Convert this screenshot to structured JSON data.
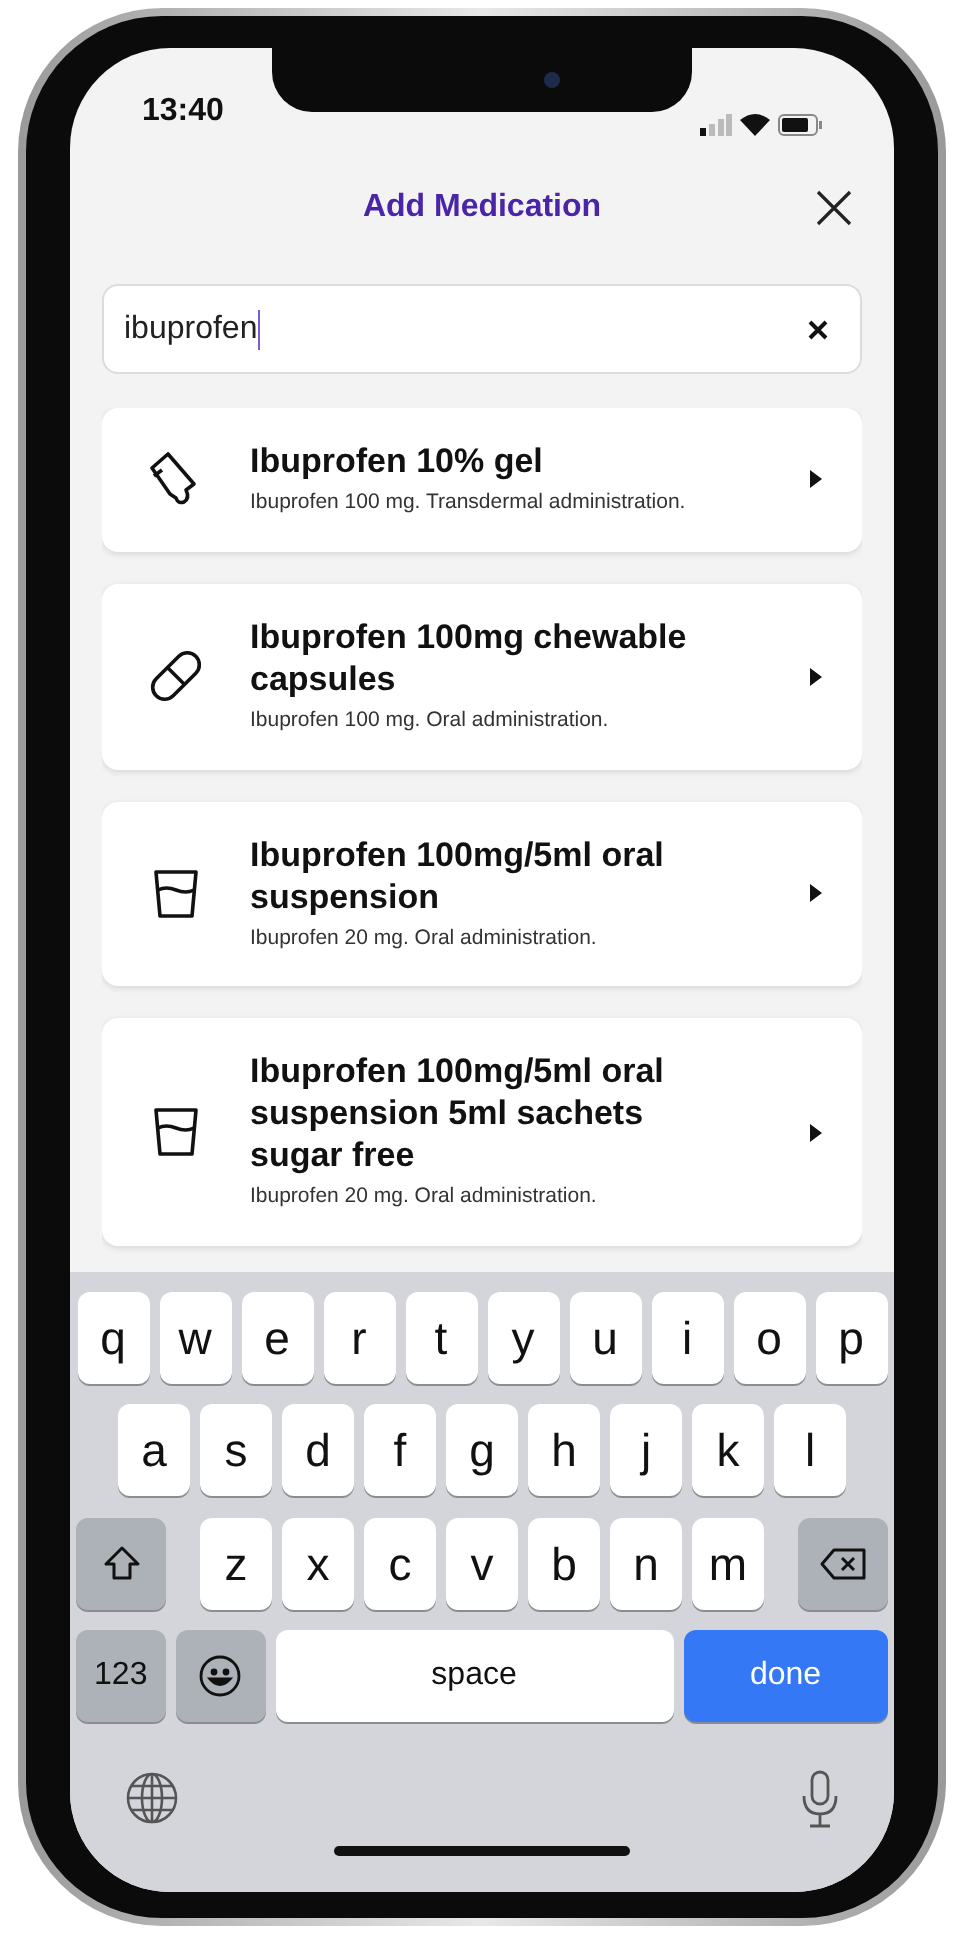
{
  "status_bar": {
    "time": "13:40"
  },
  "header": {
    "title": "Add Medication"
  },
  "search": {
    "value": "ibuprofen"
  },
  "results": [
    {
      "kind": "gel",
      "title": "Ibuprofen 10% gel",
      "detail": "Ibuprofen 100 mg. Transdermal administration."
    },
    {
      "kind": "capsule",
      "title": "Ibuprofen 100mg chewable capsules",
      "detail": "Ibuprofen 100 mg. Oral administration."
    },
    {
      "kind": "liquid",
      "title": "Ibuprofen 100mg/5ml oral suspension",
      "detail": "Ibuprofen 20 mg. Oral administration."
    },
    {
      "kind": "liquid",
      "title": "Ibuprofen 100mg/5ml oral suspension 5ml sachets sugar free",
      "detail": "Ibuprofen 20 mg. Oral administration."
    }
  ],
  "keyboard": {
    "rows": [
      [
        {
          "kind": "letter",
          "label": "q"
        },
        {
          "kind": "letter",
          "label": "w"
        },
        {
          "kind": "letter",
          "label": "e"
        },
        {
          "kind": "letter",
          "label": "r"
        },
        {
          "kind": "letter",
          "label": "t"
        },
        {
          "kind": "letter",
          "label": "y"
        },
        {
          "kind": "letter",
          "label": "u"
        },
        {
          "kind": "letter",
          "label": "i"
        },
        {
          "kind": "letter",
          "label": "o"
        },
        {
          "kind": "letter",
          "label": "p"
        }
      ],
      [
        {
          "kind": "letter",
          "label": "a"
        },
        {
          "kind": "letter",
          "label": "s"
        },
        {
          "kind": "letter",
          "label": "d"
        },
        {
          "kind": "letter",
          "label": "f"
        },
        {
          "kind": "letter",
          "label": "g"
        },
        {
          "kind": "letter",
          "label": "h"
        },
        {
          "kind": "letter",
          "label": "j"
        },
        {
          "kind": "letter",
          "label": "k"
        },
        {
          "kind": "letter",
          "label": "l"
        }
      ],
      [
        {
          "kind": "shift"
        },
        {
          "kind": "letter",
          "label": "z"
        },
        {
          "kind": "letter",
          "label": "x"
        },
        {
          "kind": "letter",
          "label": "c"
        },
        {
          "kind": "letter",
          "label": "v"
        },
        {
          "kind": "letter",
          "label": "b"
        },
        {
          "kind": "letter",
          "label": "n"
        },
        {
          "kind": "letter",
          "label": "m"
        },
        {
          "kind": "backspace"
        }
      ]
    ],
    "bottom_row": [
      {
        "kind": "numbers",
        "label": "123"
      },
      {
        "kind": "emoji"
      },
      {
        "kind": "space",
        "label": "space"
      },
      {
        "kind": "done",
        "label": "done"
      }
    ]
  }
}
